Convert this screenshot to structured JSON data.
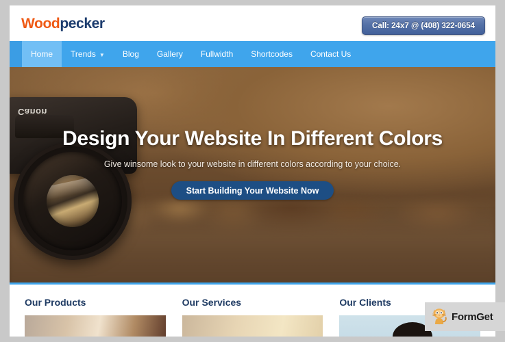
{
  "header": {
    "logo_primary": "Wood",
    "logo_secondary": "pecker",
    "call_button_label": "Call: 24x7 @ (408) 322-0654"
  },
  "nav": {
    "items": [
      {
        "label": "Home",
        "active": true,
        "has_dropdown": false
      },
      {
        "label": "Trends",
        "active": false,
        "has_dropdown": true
      },
      {
        "label": "Blog",
        "active": false,
        "has_dropdown": false
      },
      {
        "label": "Gallery",
        "active": false,
        "has_dropdown": false
      },
      {
        "label": "Fullwidth",
        "active": false,
        "has_dropdown": false
      },
      {
        "label": "Shortcodes",
        "active": false,
        "has_dropdown": false
      },
      {
        "label": "Contact Us",
        "active": false,
        "has_dropdown": false
      }
    ],
    "caret_glyph": "▼"
  },
  "hero": {
    "title": "Design Your Website In Different Colors",
    "subtitle": "Give winsome look to your website in different colors according to your choice.",
    "cta_label": "Start Building Your Website Now",
    "camera_brand": "Canon"
  },
  "columns": [
    {
      "title": "Our Products"
    },
    {
      "title": "Our Services"
    },
    {
      "title": "Our Clients"
    }
  ],
  "watermark": {
    "label": "FormGet"
  },
  "colors": {
    "logo_orange": "#ef5a15",
    "logo_navy": "#1c3c6e",
    "nav_blue": "#3fa5ec",
    "nav_active_blue": "#72bff5",
    "cta_navy": "#1d4e84",
    "heading_navy": "#1f3b63",
    "page_surround_gray": "#c9c9c9"
  }
}
